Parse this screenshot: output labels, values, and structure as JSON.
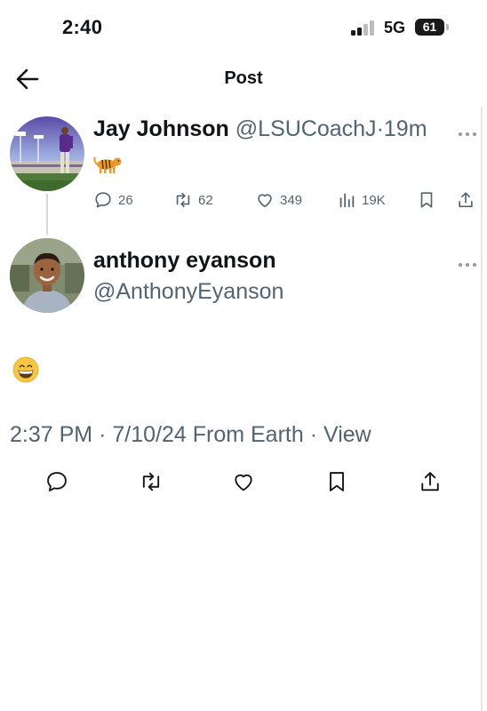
{
  "status_bar": {
    "time": "2:40",
    "network": "5G",
    "battery": "61"
  },
  "header": {
    "title": "Post",
    "back_icon": "arrow-left-icon"
  },
  "parent_tweet": {
    "display_name": "Jay Johnson",
    "handle": "@LSUCoachJ",
    "separator": "·",
    "age": "19m",
    "content_emoji": "tiger",
    "more_icon": "more-horizontal-icon",
    "actions": {
      "replies": "26",
      "reposts": "62",
      "likes": "349",
      "views": "19K"
    }
  },
  "post": {
    "display_name": "anthony eyanson",
    "handle": "@AnthonyEyanson",
    "content_emoji": "grinning-face",
    "time": "2:37 PM",
    "date": "7/10/24",
    "source": "From Earth",
    "separator": "·",
    "view_label": "View",
    "more_icon": "more-horizontal-icon"
  },
  "colors": {
    "text_primary": "#0f1419",
    "text_secondary": "#536471",
    "thread_line": "#cfd9de",
    "battery_bg": "#1a1a1a"
  }
}
